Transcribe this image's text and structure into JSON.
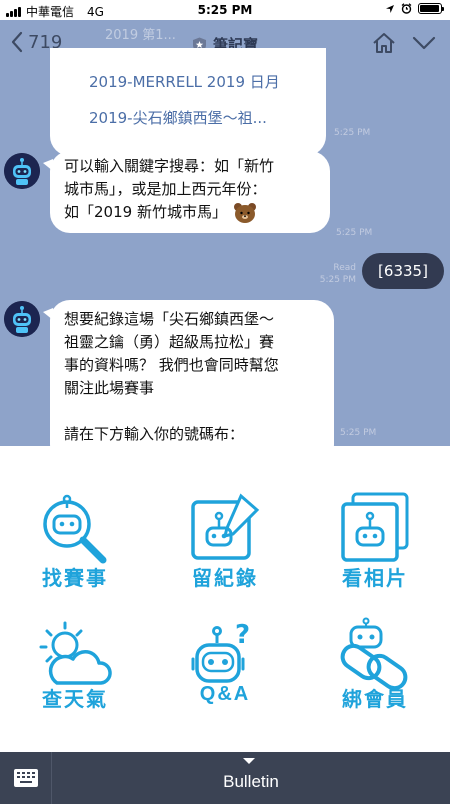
{
  "status_bar": {
    "carrier": "中華電信",
    "network": "4G",
    "time": "5:25 PM",
    "battery_level": 0.95
  },
  "nav": {
    "back_count": "719",
    "title": "筆記寶",
    "faded_header_text": "2019 第1..."
  },
  "messages": {
    "link_list": [
      "2019-MERRELL 2019 日月",
      "2019-尖石鄉鎮西堡～祖..."
    ],
    "link_list_time": "5:25 PM",
    "msg1_lines": [
      "可以輸入關鍵字搜尋：如「新竹",
      "城市馬」，或是加上西元年份：",
      "如「2019 新竹城市馬」"
    ],
    "msg1_time": "5:25 PM",
    "outgoing_text": "[6335]",
    "outgoing_read": "Read",
    "outgoing_time": "5:25 PM",
    "msg2_lines": [
      "想要紀錄這場「尖石鄉鎮西堡～",
      "祖靈之鑰（勇）超級馬拉松」賽",
      "事的資料嗎？ 我們也會同時幫您",
      "關注此場賽事",
      "",
      "請在下方輸入你的號碼布："
    ],
    "msg2_time": "5:25 PM"
  },
  "rich_menu": {
    "items": [
      {
        "label": "找賽事",
        "icon": "magnifier-robot-icon"
      },
      {
        "label": "留紀錄",
        "icon": "robot-pencil-icon"
      },
      {
        "label": "看相片",
        "icon": "robot-photo-icon"
      },
      {
        "label": "查天氣",
        "icon": "sun-cloud-icon"
      },
      {
        "label": "Q&A",
        "icon": "robot-question-icon"
      },
      {
        "label": "綁會員",
        "icon": "robot-chain-icon"
      }
    ],
    "accent_color": "#1fa3db"
  },
  "bottom_bar": {
    "label": "Bulletin",
    "keyboard_icon": "keyboard-icon"
  }
}
